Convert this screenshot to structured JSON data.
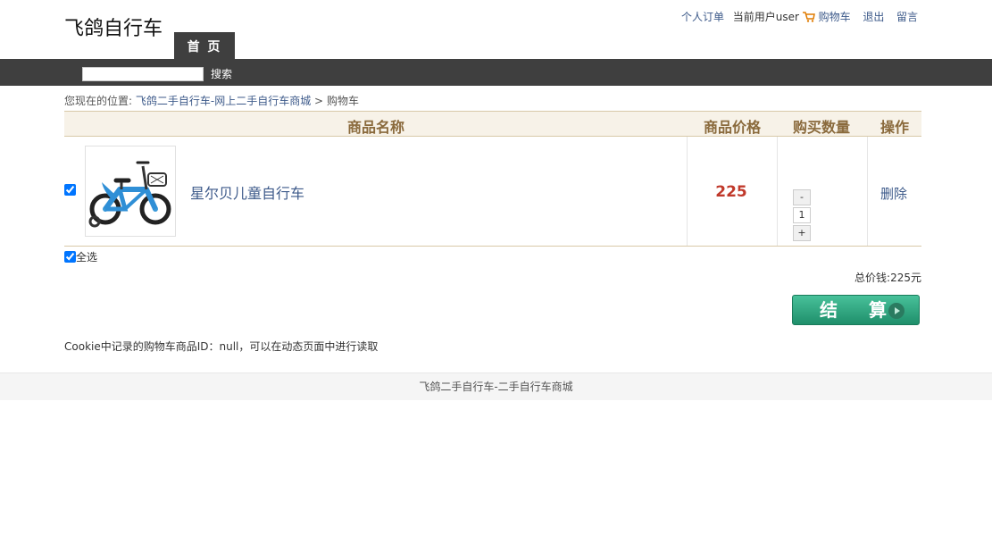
{
  "header": {
    "logo": "飞鸽自行车",
    "nav_home": "首 页",
    "links": {
      "orders": "个人订单",
      "current_user_prefix": "当前用户",
      "username": "user",
      "cart": "购物车",
      "logout": "退出",
      "message": "留言"
    }
  },
  "search": {
    "button": "搜索",
    "value": ""
  },
  "breadcrumb": {
    "prefix": "您现在的位置:",
    "home": "飞鸽二手自行车-网上二手自行车商城",
    "separator": ">",
    "current": "购物车"
  },
  "cart": {
    "columns": {
      "name": "商品名称",
      "price": "商品价格",
      "quantity": "购买数量",
      "operation": "操作"
    },
    "items": [
      {
        "name": "星尔贝儿童自行车",
        "price": "225",
        "quantity": "1",
        "minus": "-",
        "plus": "+",
        "delete": "删除"
      }
    ],
    "select_all": "全选",
    "total": "总价钱:225元",
    "checkout": "结 算"
  },
  "cookie_note": "Cookie中记录的购物车商品ID：null，可以在动态页面中进行读取",
  "footer": "飞鸽二手自行车-二手自行车商城",
  "colors": {
    "nav_bg": "#3f3f3f",
    "link": "#3d5a8a",
    "price": "#c0392b",
    "header_text": "#8a6a3c",
    "checkout": "#2fa37e"
  }
}
